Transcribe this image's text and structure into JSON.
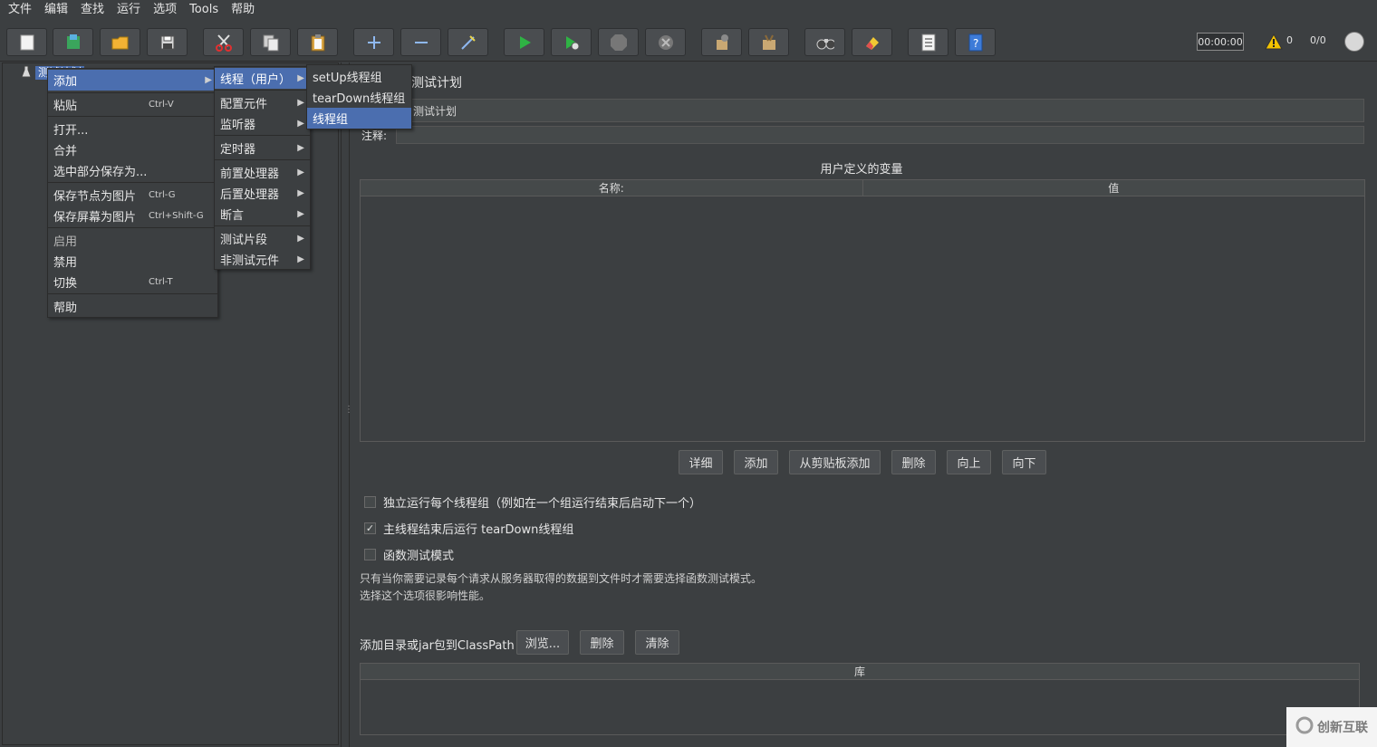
{
  "menubar": [
    "文件",
    "编辑",
    "查找",
    "运行",
    "选项",
    "Tools",
    "帮助"
  ],
  "toolbar": {
    "timer": "00:00:00",
    "warning_count": "0",
    "thread_ratio": "0/0"
  },
  "tree": {
    "root_label": "测试计划"
  },
  "context_menu": {
    "items": [
      {
        "label": "添加",
        "submenu": true
      },
      {
        "label": "粘贴",
        "shortcut": "Ctrl-V"
      },
      {
        "label": "打开..."
      },
      {
        "label": "合并"
      },
      {
        "label": "选中部分保存为..."
      },
      {
        "label": "保存节点为图片",
        "shortcut": "Ctrl-G"
      },
      {
        "label": "保存屏幕为图片",
        "shortcut": "Ctrl+Shift-G"
      },
      {
        "label": "启用"
      },
      {
        "label": "禁用"
      },
      {
        "label": "切换",
        "shortcut": "Ctrl-T"
      },
      {
        "label": "帮助"
      }
    ]
  },
  "add_menu": {
    "items": [
      "线程（用户）",
      "配置元件",
      "监听器",
      "定时器",
      "前置处理器",
      "后置处理器",
      "断言",
      "测试片段",
      "非测试元件"
    ]
  },
  "thread_menu": {
    "items": [
      "setUp线程组",
      "tearDown线程组",
      "线程组"
    ]
  },
  "panel": {
    "title": "测试计划",
    "name_value": "测试计划",
    "comment_label": "注释:",
    "udv_title": "用户定义的变量",
    "udv_columns": [
      "名称:",
      "值"
    ],
    "buttons": [
      "详细",
      "添加",
      "从剪贴板添加",
      "删除",
      "向上",
      "向下"
    ],
    "checkbox_1": "独立运行每个线程组（例如在一个组运行结束后启动下一个）",
    "checkbox_2": "主线程结束后运行 tearDown线程组",
    "checkbox_3": "函数测试模式",
    "note_1": "只有当你需要记录每个请求从服务器取得的数据到文件时才需要选择函数测试模式。",
    "note_2": "选择这个选项很影响性能。",
    "classpath_label": "添加目录或jar包到ClassPath",
    "classpath_buttons": [
      "浏览...",
      "删除",
      "清除"
    ],
    "lib_column": "库"
  },
  "watermark": "创新互联"
}
